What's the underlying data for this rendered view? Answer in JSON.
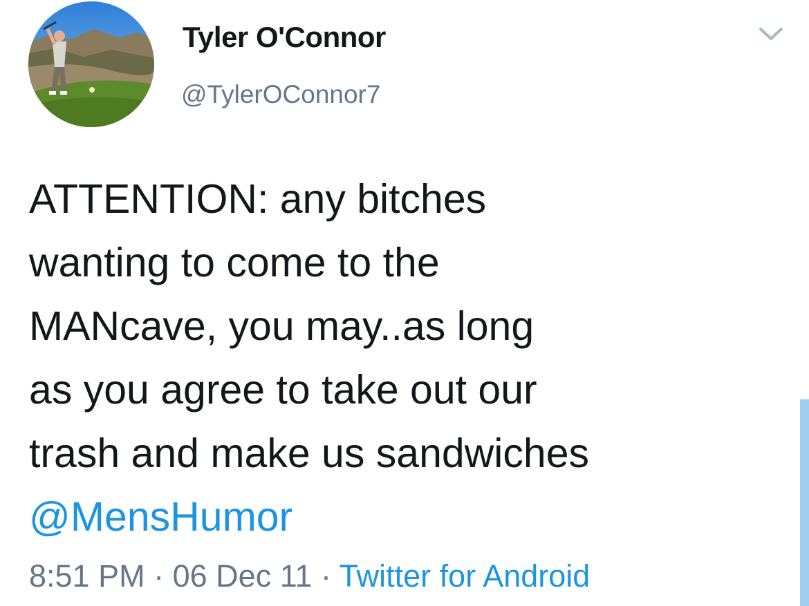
{
  "author": {
    "display_name": "Tyler O'Connor",
    "handle": "@TylerOConnor7",
    "avatar_icon": "golfer-avatar"
  },
  "tweet": {
    "lines": [
      "ATTENTION: any bitches",
      "wanting to come to the",
      "MANcave, you may..as long",
      "as you agree to take out our",
      "trash and make us sandwiches"
    ],
    "mention": "@MensHumor"
  },
  "meta": {
    "time": "8:51 PM",
    "separator": "·",
    "date": "06 Dec 11",
    "source": "Twitter for Android"
  },
  "menu_icon": "chevron-down-icon",
  "colors": {
    "text": "#14171a",
    "secondary": "#657786",
    "link": "#1b95e0"
  }
}
